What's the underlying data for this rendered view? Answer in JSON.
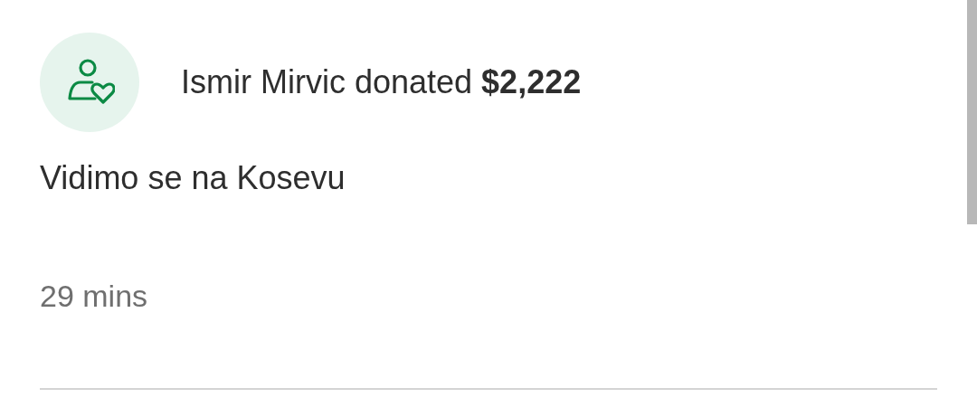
{
  "donation": {
    "headline": "Ismir Mirvic donated **$2,222**",
    "message": "Vidimo se na Kosevu",
    "time": "29 mins"
  }
}
